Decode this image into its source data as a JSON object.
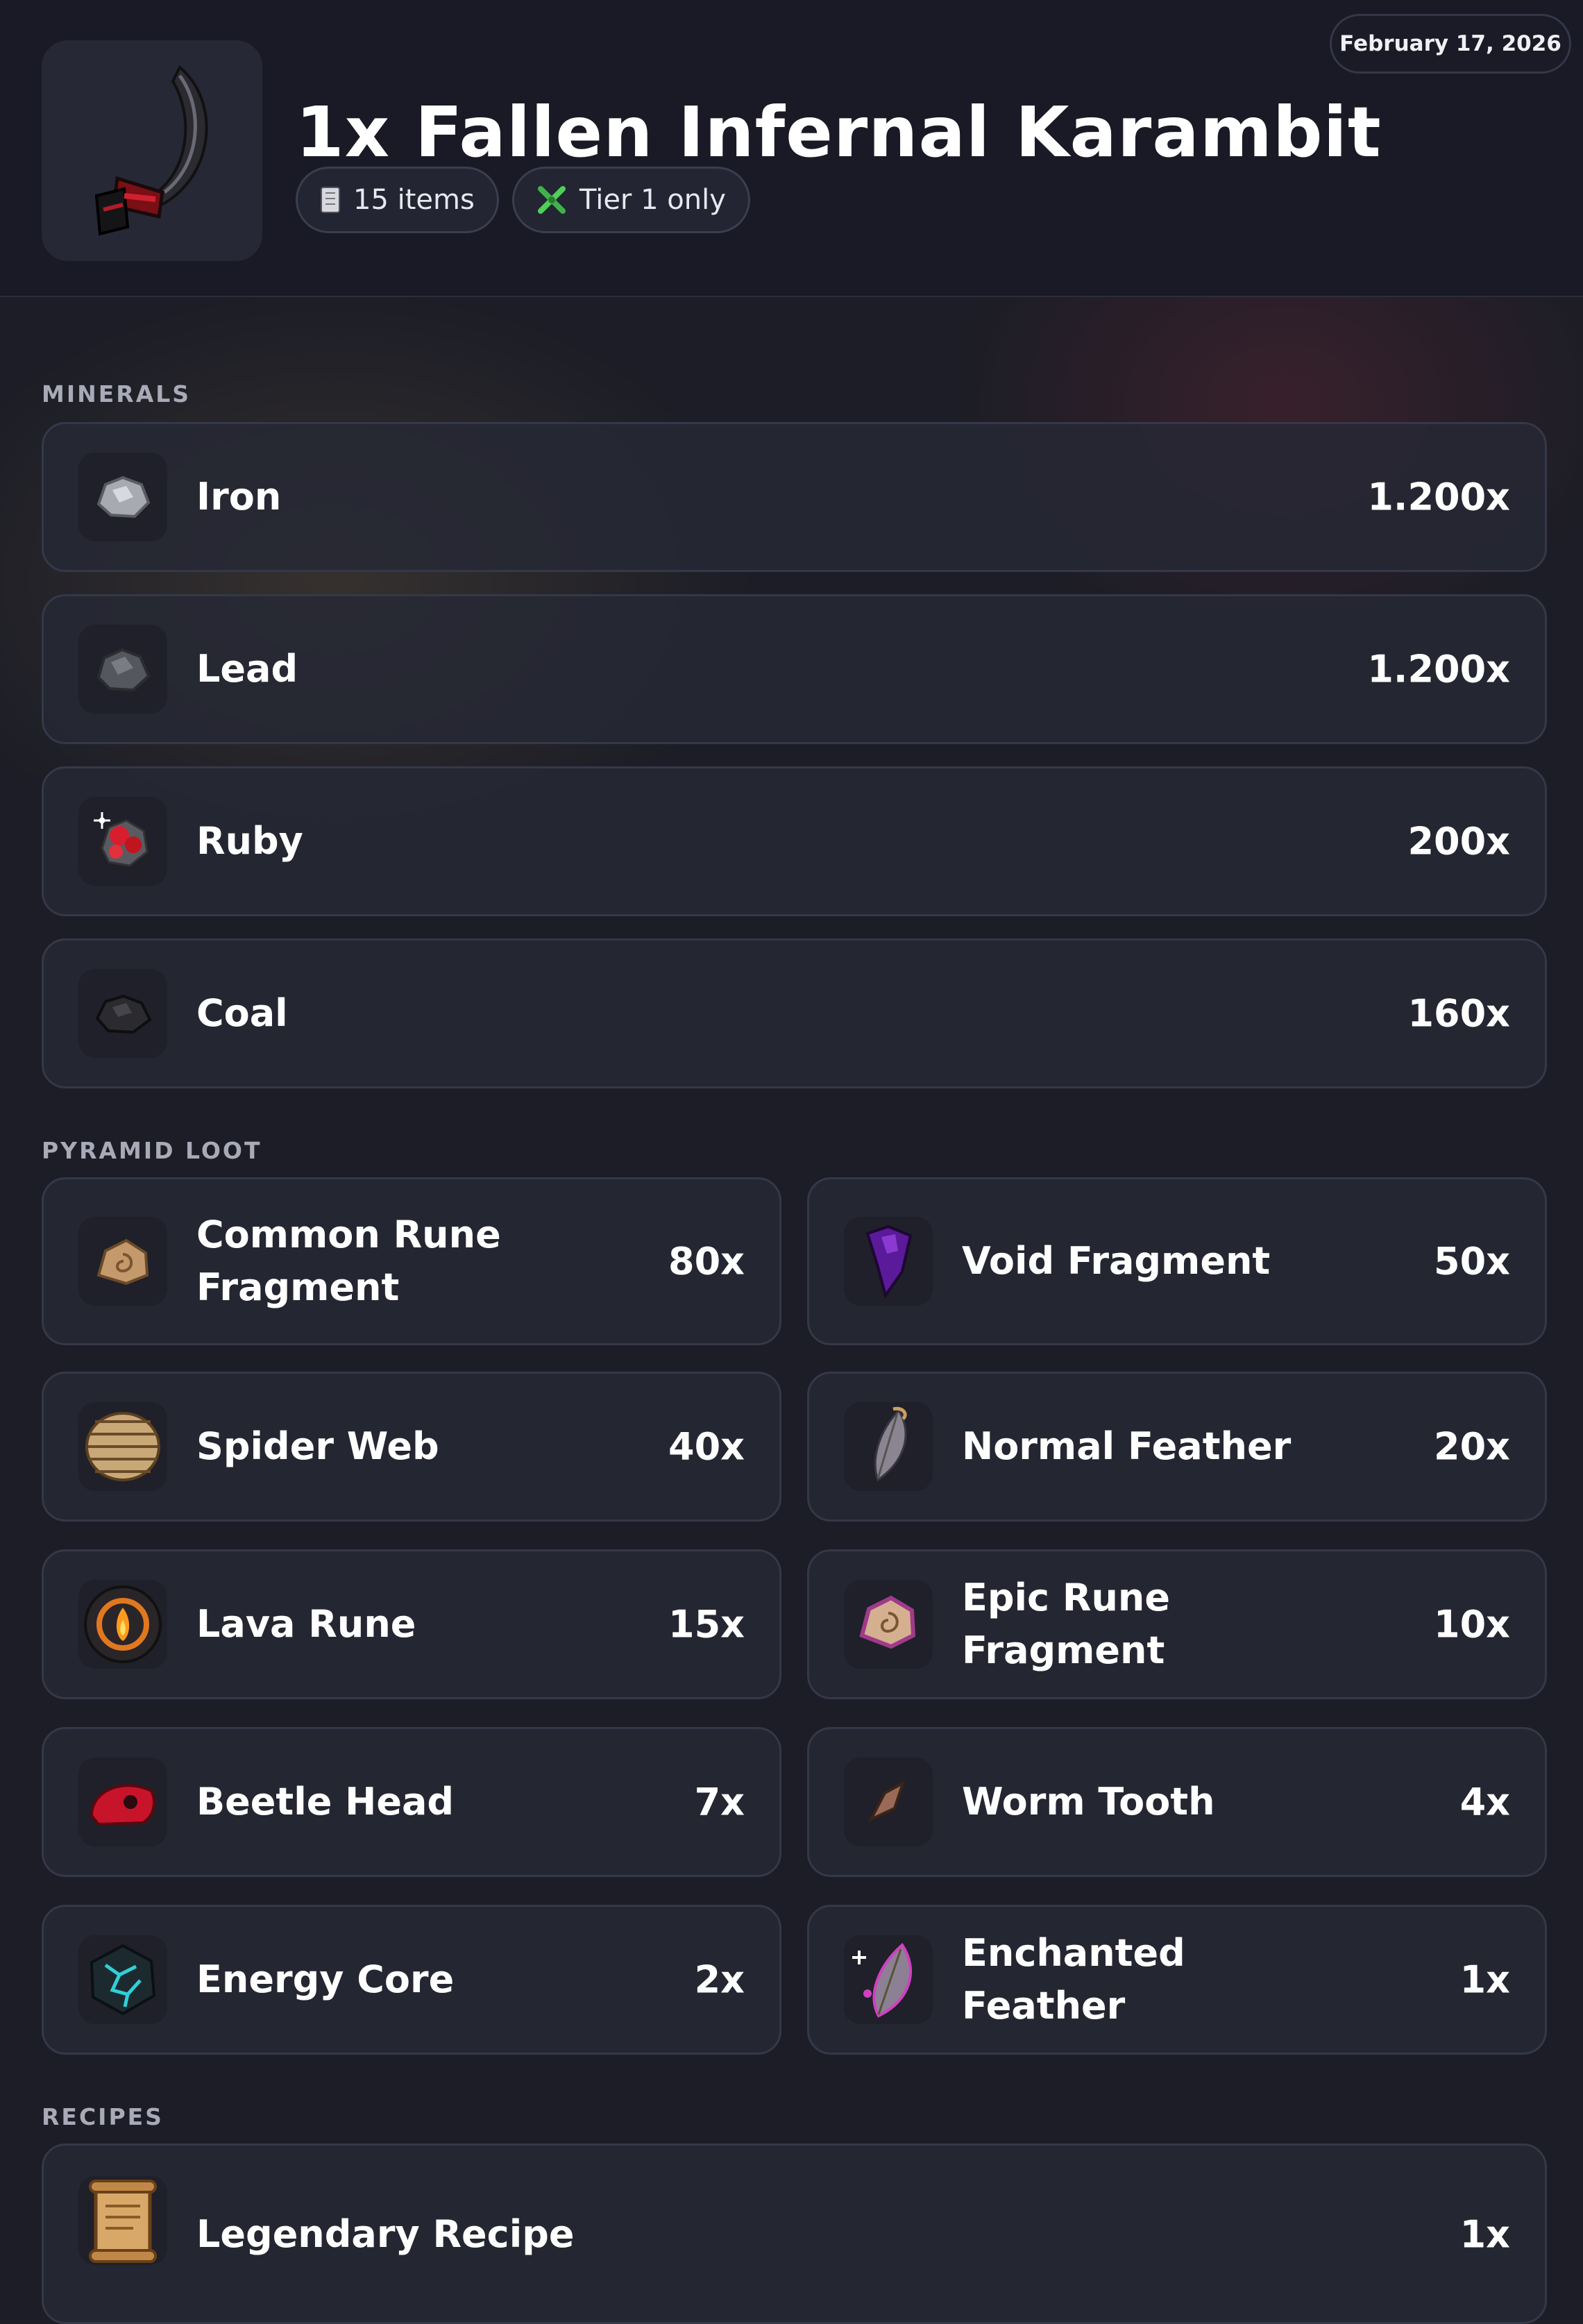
{
  "header": {
    "title": "1x Fallen Infernal Karambit",
    "items_chip": "15 items",
    "tier_chip": "Tier 1 only",
    "date": "February 17, 2026",
    "hero_icon": "karambit-icon"
  },
  "sections": {
    "minerals": "MINERALS",
    "pyramid": "PYRAMID LOOT",
    "recipes": "RECIPES"
  },
  "minerals": [
    {
      "name": "Iron",
      "qty": "1.200x",
      "icon": "iron-ore-icon"
    },
    {
      "name": "Lead",
      "qty": "1.200x",
      "icon": "lead-ore-icon"
    },
    {
      "name": "Ruby",
      "qty": "200x",
      "icon": "ruby-icon"
    },
    {
      "name": "Coal",
      "qty": "160x",
      "icon": "coal-icon"
    }
  ],
  "pyramid": [
    {
      "name": "Common Rune Fragment",
      "qty": "80x",
      "icon": "common-rune-fragment-icon"
    },
    {
      "name": "Void Fragment",
      "qty": "50x",
      "icon": "void-fragment-icon"
    },
    {
      "name": "Spider Web",
      "qty": "40x",
      "icon": "spider-web-icon"
    },
    {
      "name": "Normal Feather",
      "qty": "20x",
      "icon": "feather-icon"
    },
    {
      "name": "Lava Rune",
      "qty": "15x",
      "icon": "lava-rune-icon"
    },
    {
      "name": "Epic Rune Fragment",
      "qty": "10x",
      "icon": "epic-rune-fragment-icon"
    },
    {
      "name": "Beetle Head",
      "qty": "7x",
      "icon": "beetle-head-icon"
    },
    {
      "name": "Worm Tooth",
      "qty": "4x",
      "icon": "worm-tooth-icon"
    },
    {
      "name": "Energy Core",
      "qty": "2x",
      "icon": "energy-core-icon"
    },
    {
      "name": "Enchanted Feather",
      "qty": "1x",
      "icon": "enchanted-feather-icon"
    }
  ],
  "recipes": [
    {
      "name": "Legendary Recipe",
      "qty": "1x",
      "icon": "scroll-icon"
    }
  ]
}
